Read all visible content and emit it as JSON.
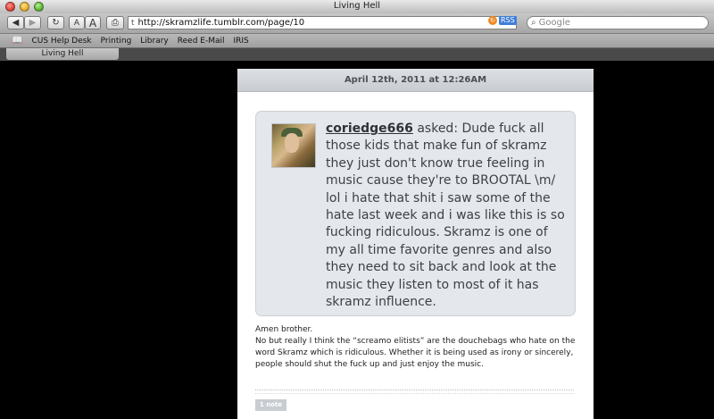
{
  "window": {
    "title": "Living Hell"
  },
  "toolbar": {
    "back_icon": "back-arrow",
    "forward_icon": "forward-arrow",
    "reload_icon": "reload",
    "text_smaller": "A",
    "text_bigger": "A",
    "print_icon": "printer",
    "url": "http://skramzlife.tumblr.com/page/10",
    "rss_label": "RSS",
    "search_placeholder": "Google"
  },
  "bookmarks": [
    "CUS Help Desk",
    "Printing",
    "Library",
    "Reed E-Mail",
    "IRIS"
  ],
  "tab": {
    "label": "Living Hell"
  },
  "post": {
    "date": "April 12th, 2011 at 12:26AM",
    "asker": "coriedge666",
    "asked_word": " asked:",
    "question": " Dude fuck all those kids that make fun of skramz they just don't know true feeling in music cause they're to BROOTAL \\m/ lol i hate that shit i saw some of the hate last week and i was like this is so fucking ridiculous. Skramz is one of my all time favorite genres and also they need to sit back and look at the music they listen to most of it has skramz influence.",
    "answer_line1": "Amen brother.",
    "answer_line2": "No but really I think the “screamo elitists” are the douchebags who hate on the word Skramz which is ridiculous. Whether it is being used as irony or sincerely, people should shut the fuck up and just enjoy the music.",
    "notes": "1 note"
  },
  "colors": {
    "page_background": "#000000",
    "ask_bubble": "#e4e7eb",
    "date_bar": "#d2d6da",
    "notes_badge": "#c9cdd2"
  }
}
